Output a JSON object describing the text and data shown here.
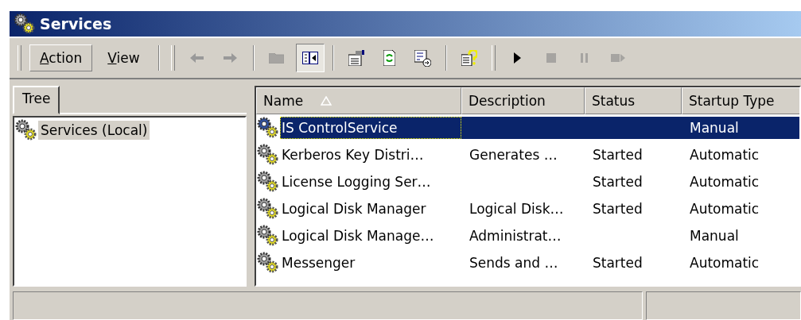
{
  "window": {
    "title": "Services"
  },
  "menu": [
    {
      "label": "Action",
      "selected": true
    },
    {
      "label": "View",
      "selected": false
    }
  ],
  "toolbar": [
    {
      "kind": "back",
      "disabled": false,
      "pressed": false
    },
    {
      "kind": "forward",
      "disabled": false,
      "pressed": false
    },
    {
      "kind": "sep"
    },
    {
      "kind": "up",
      "disabled": true,
      "pressed": false
    },
    {
      "kind": "tree",
      "disabled": false,
      "pressed": true
    },
    {
      "kind": "sep"
    },
    {
      "kind": "properties",
      "disabled": false,
      "pressed": false
    },
    {
      "kind": "refresh",
      "disabled": false,
      "pressed": false
    },
    {
      "kind": "export",
      "disabled": false,
      "pressed": false
    },
    {
      "kind": "sep"
    },
    {
      "kind": "help",
      "disabled": false,
      "pressed": false
    },
    {
      "kind": "grip"
    },
    {
      "kind": "play",
      "disabled": false,
      "pressed": false
    },
    {
      "kind": "stop",
      "disabled": true,
      "pressed": false
    },
    {
      "kind": "pause",
      "disabled": true,
      "pressed": false
    },
    {
      "kind": "restart",
      "disabled": true,
      "pressed": false
    }
  ],
  "tabs": [
    {
      "label": "Tree",
      "selected": true
    }
  ],
  "tree": {
    "items": [
      {
        "label": "Services (Local)",
        "selected": true
      }
    ]
  },
  "table": {
    "columns": [
      {
        "label": "Name",
        "sorted": true
      },
      {
        "label": "Description",
        "sorted": false
      },
      {
        "label": "Status",
        "sorted": false
      },
      {
        "label": "Startup Type",
        "sorted": false
      }
    ],
    "rows": [
      {
        "name": "IS ControlService",
        "description": "",
        "status": "",
        "startup": "Manual",
        "selected": true
      },
      {
        "name": "Kerberos Key Distri…",
        "description": "Generates …",
        "status": "Started",
        "startup": "Automatic",
        "selected": false
      },
      {
        "name": "License Logging Ser…",
        "description": "",
        "status": "Started",
        "startup": "Automatic",
        "selected": false
      },
      {
        "name": "Logical Disk Manager",
        "description": "Logical Disk…",
        "status": "Started",
        "startup": "Automatic",
        "selected": false
      },
      {
        "name": "Logical Disk Manage…",
        "description": "Administrat…",
        "status": "",
        "startup": "Manual",
        "selected": false
      },
      {
        "name": "Messenger",
        "description": "Sends and …",
        "status": "Started",
        "startup": "Automatic",
        "selected": false
      }
    ]
  }
}
